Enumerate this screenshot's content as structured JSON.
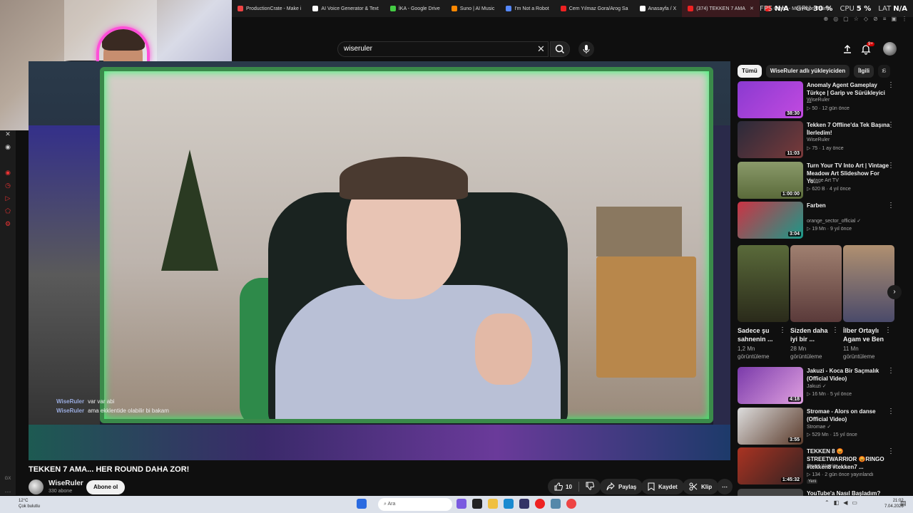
{
  "browser": {
    "tabs": [
      {
        "label": "ProductionCrate - Make i",
        "color": "#e44"
      },
      {
        "label": "AI Voice Generator & Text",
        "color": "#fff"
      },
      {
        "label": "İKA - Google Drive",
        "color": "#4c4"
      },
      {
        "label": "Suno | AI Music",
        "color": "#f80"
      },
      {
        "label": "I'm Not a Robot",
        "color": "#58f"
      },
      {
        "label": "Cem Yılmaz Gora/Arog Sa",
        "color": "#e22"
      },
      {
        "label": "Anasayfa / X",
        "color": "#fff"
      }
    ],
    "active_tab": {
      "label": "(374) TEKKEN 7 AMA",
      "color": "#e22"
    },
    "extra_tab": {
      "label": "Creed - Motivation Trainin",
      "color": "#e22"
    }
  },
  "overlay_stats": {
    "fps_label": "FPS",
    "fps_value": "N/A",
    "gpu_label": "GPU",
    "gpu_value": "30 %",
    "cpu_label": "CPU",
    "cpu_value": "5 %",
    "lat_label": "LAT",
    "lat_value": "N/A"
  },
  "header": {
    "search_value": "wiseruler",
    "notification_count": "9+"
  },
  "chat": [
    {
      "user": "WiseRuler",
      "msg": "var var abi"
    },
    {
      "user": "WiseRuler",
      "msg": "ama ekklentide olabilir bi bakam"
    }
  ],
  "video": {
    "title": "TEKKEN 7 AMA... HER ROUND DAHA ZOR!",
    "channel": "WiseRuler",
    "subs": "330 abone",
    "subscribe": "Abone ol",
    "likes": "10",
    "share": "Paylaş",
    "save": "Kaydet",
    "clip": "Klip"
  },
  "chips": [
    "Tümü",
    "WiseRuler adlı yükleyiciden",
    "İlgili",
    "S"
  ],
  "recommendations": [
    {
      "title": "Anomaly Agent Gameplay Türkçe | Garip ve Sürükleyici ...",
      "channel": "WiseRuler",
      "meta": "▷ 50 · 12 gün önce",
      "duration": "38:30",
      "color": "#8a3ad0"
    },
    {
      "title": "Tekken 7 Offline'da Tek Başına İlerledim!",
      "channel": "WiseRuler",
      "meta": "▷ 75 · 1 ay önce",
      "duration": "11:03",
      "color": "#6a2a2a"
    },
    {
      "title": "Turn Your TV Into Art | Vintage Meadow Art Slideshow For Yo...",
      "channel": "Vintage Art TV",
      "meta": "▷ 620 B · 4 yıl önce",
      "duration": "1:00:00",
      "color": "#6a7a4a"
    },
    {
      "title": "Farben",
      "channel": "orange_sector_official ✓",
      "meta": "▷ 19 Mn · 9 yıl önce",
      "duration": "3:04",
      "color": "#cc3344"
    }
  ],
  "recommendations2": [
    {
      "title": "Jakuzi - Koca Bir Saçmalık (Official Video)",
      "channel": "Jakuzi ✓",
      "meta": "▷ 16 Mn · 5 yıl önce",
      "duration": "4:18",
      "color": "#7a3aaa"
    },
    {
      "title": "Stromae - Alors on danse (Official Video)",
      "channel": "Stromae ✓",
      "meta": "▷ 529 Mn · 15 yıl önce",
      "duration": "3:55",
      "color": "#444"
    },
    {
      "title": "TEKKEN 8 😡STREETWARRIOR 😡RINGO #tekken8 #tekken7 ...",
      "channel": "Street Warrior",
      "meta": "▷ 134 · 2 gün önce yayınlandı",
      "duration": "1:45:32",
      "color": "#aa3322",
      "badge": "Yeni"
    },
    {
      "title": "YouTube'a Nasıl Başladım?",
      "channel": "",
      "meta": "",
      "duration": "",
      "color": "#444"
    }
  ],
  "shorts": [
    {
      "title": "Sadece şu sahnenin ...",
      "views": "1,2 Mn görüntüleme",
      "color": "#3a5a2a"
    },
    {
      "title": "Sizden daha iyi bir ...",
      "views": "28 Mn görüntüleme",
      "color": "#8a5a4a"
    },
    {
      "title": "İlber Ortaylı Agam ve Ben",
      "views": "11 Mn görüntüleme",
      "color": "#6a5a3a"
    }
  ],
  "taskbar": {
    "weather_temp": "12°C",
    "weather_desc": "Çok bulutlu",
    "search": "Ara",
    "time": "21:02",
    "date": "7.04.2026"
  },
  "watermark_left": "GX"
}
